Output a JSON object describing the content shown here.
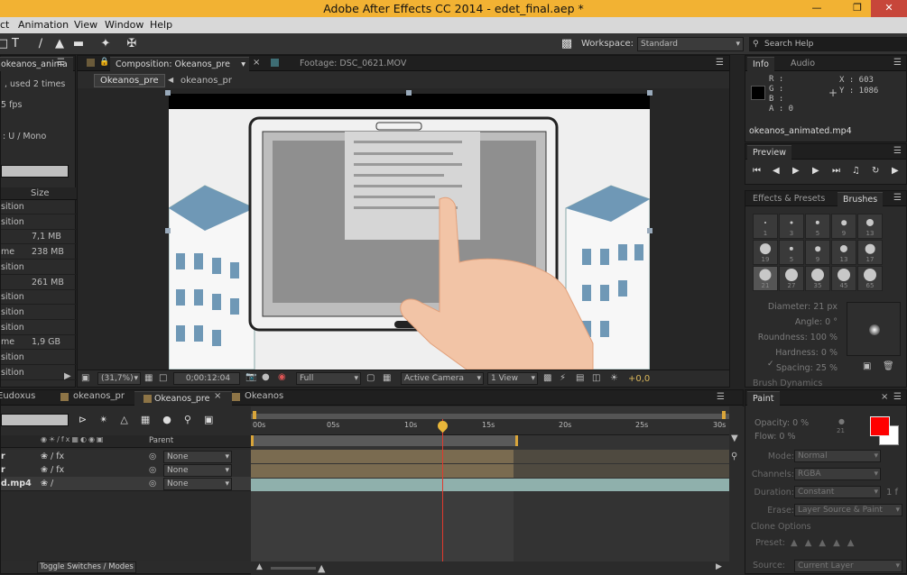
{
  "app": {
    "title": "Adobe After Effects CC 2014 - edet_final.aep *",
    "title_color": "#f2b233"
  },
  "menu": [
    "ct",
    "Animation",
    "View",
    "Window",
    "Help"
  ],
  "toolbar": {
    "workspace_label": "Workspace:",
    "workspace_value": "Standard",
    "search_placeholder": "Search Help"
  },
  "project": {
    "tab": "okeanos_anima",
    "used": ", used 2 times",
    "fps": "5 fps",
    "audio": ": U / Mono",
    "size_header": "Size",
    "rows": [
      {
        "name": "sition",
        "size": ""
      },
      {
        "name": "sition",
        "size": ""
      },
      {
        "name": "",
        "size": "7,1 MB"
      },
      {
        "name": "me",
        "size": "238 MB"
      },
      {
        "name": "sition",
        "size": ""
      },
      {
        "name": "",
        "size": "261 MB"
      },
      {
        "name": "sition",
        "size": ""
      },
      {
        "name": "sition",
        "size": ""
      },
      {
        "name": "sition",
        "size": ""
      },
      {
        "name": "me",
        "size": "1,9 GB"
      },
      {
        "name": "sition",
        "size": ""
      },
      {
        "name": "sition",
        "size": ""
      }
    ]
  },
  "comp_panel": {
    "tab_comp": "Composition: Okeanos_pre",
    "tab_footage": "Footage: DSC_0621.MOV",
    "crumb_1": "Okeanos_pre",
    "crumb_2": "okeanos_pr",
    "zoom": "(31,7%)",
    "timecode": "0;00:12:04",
    "quality": "Full",
    "camera": "Active Camera",
    "views": "1 View",
    "exposure": "+0,0"
  },
  "info": {
    "tab_info": "Info",
    "tab_audio": "Audio",
    "r": "R :",
    "g": "G :",
    "b": "B :",
    "a": "A : 0",
    "x": "X : 603",
    "y": "Y : 1086",
    "file": "okeanos_animated.mp4"
  },
  "preview": {
    "tab": "Preview"
  },
  "brushes": {
    "tab_effects": "Effects & Presets",
    "tab_brushes": "Brushes",
    "sizes": [
      "1",
      "3",
      "5",
      "9",
      "13",
      "19",
      "5",
      "9",
      "13",
      "17",
      "21",
      "27",
      "35",
      "45",
      "65"
    ],
    "diameter": "Diameter: 21 px",
    "angle": "Angle: 0 °",
    "roundness": "Roundness: 100 %",
    "hardness": "Hardness: 0 %",
    "spacing": "Spacing: 25 %",
    "dynamics": "Brush Dynamics"
  },
  "paint": {
    "tab": "Paint",
    "opacity": "Opacity: 0 %",
    "flow": "Flow: 0 %",
    "brush_size": "21",
    "mode_label": "Mode:",
    "mode": "Normal",
    "channels_label": "Channels:",
    "channels": "RGBA",
    "duration_label": "Duration:",
    "duration": "Constant",
    "frames": "1 f",
    "erase_label": "Erase:",
    "erase": "Layer Source & Paint",
    "clone_options": "Clone Options",
    "preset_label": "Preset:",
    "source_label": "Source:",
    "source": "Current Layer",
    "fg_color": "#ff0000",
    "bg_color": "#ffffff"
  },
  "timeline": {
    "tabs": [
      "Eudoxus",
      "okeanos_pr",
      "Okeanos_pre",
      "Okeanos"
    ],
    "parent_header": "Parent",
    "none": "None",
    "layer3": "d.mp4",
    "ruler": [
      "00s",
      "05s",
      "10s",
      "15s",
      "20s",
      "25s",
      "30s"
    ],
    "toggle": "Toggle Switches / Modes"
  }
}
